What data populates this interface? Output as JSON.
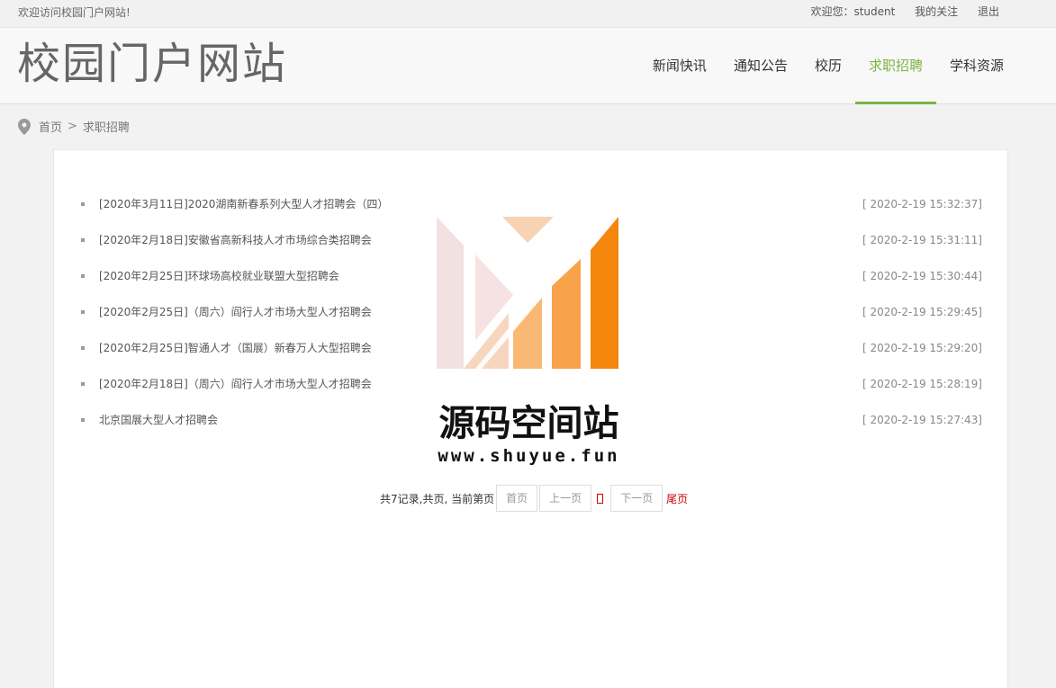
{
  "topbar": {
    "welcome": "欢迎访问校园门户网站!",
    "user_greeting": "欢迎您：student",
    "my_follow": "我的关注",
    "logout": "退出"
  },
  "header": {
    "site_title": "校园门户网站",
    "nav": [
      {
        "label": "新闻快讯",
        "active": false
      },
      {
        "label": "通知公告",
        "active": false
      },
      {
        "label": "校历",
        "active": false
      },
      {
        "label": "求职招聘",
        "active": true
      },
      {
        "label": "学科资源",
        "active": false
      }
    ],
    "accent_color": "#7cb342"
  },
  "breadcrumb": {
    "home": "首页",
    "separator": ">",
    "current": "求职招聘",
    "icon": "location-pin-icon"
  },
  "list": [
    {
      "title": "[2020年3月11日]2020湖南新春系列大型人才招聘会（四）",
      "date": "[ 2020-2-19 15:32:37]"
    },
    {
      "title": "[2020年2月18日]安徽省高新科技人才市场综合类招聘会",
      "date": "[ 2020-2-19 15:31:11]"
    },
    {
      "title": "[2020年2月25日]环球场高校就业联盟大型招聘会",
      "date": "[ 2020-2-19 15:30:44]"
    },
    {
      "title": "[2020年2月25日]（周六）阎行人才市场大型人才招聘会",
      "date": "[ 2020-2-19 15:29:45]"
    },
    {
      "title": "[2020年2月25日]智通人才（国展）新春万人大型招聘会",
      "date": "[ 2020-2-19 15:29:20]"
    },
    {
      "title": "[2020年2月18日]（周六）阎行人才市场大型人才招聘会",
      "date": "[ 2020-2-19 15:28:19]"
    },
    {
      "title": "北京国展大型人才招聘会",
      "date": "[ 2020-2-19 15:27:43]"
    }
  ],
  "pager": {
    "summary": "共7记录,共页, 当前第页",
    "first": "首页",
    "prev": "上一页",
    "next": "下一页",
    "last": "尾页"
  },
  "watermark": {
    "text": "源码空间站",
    "url": "www.shuyue.fun"
  }
}
